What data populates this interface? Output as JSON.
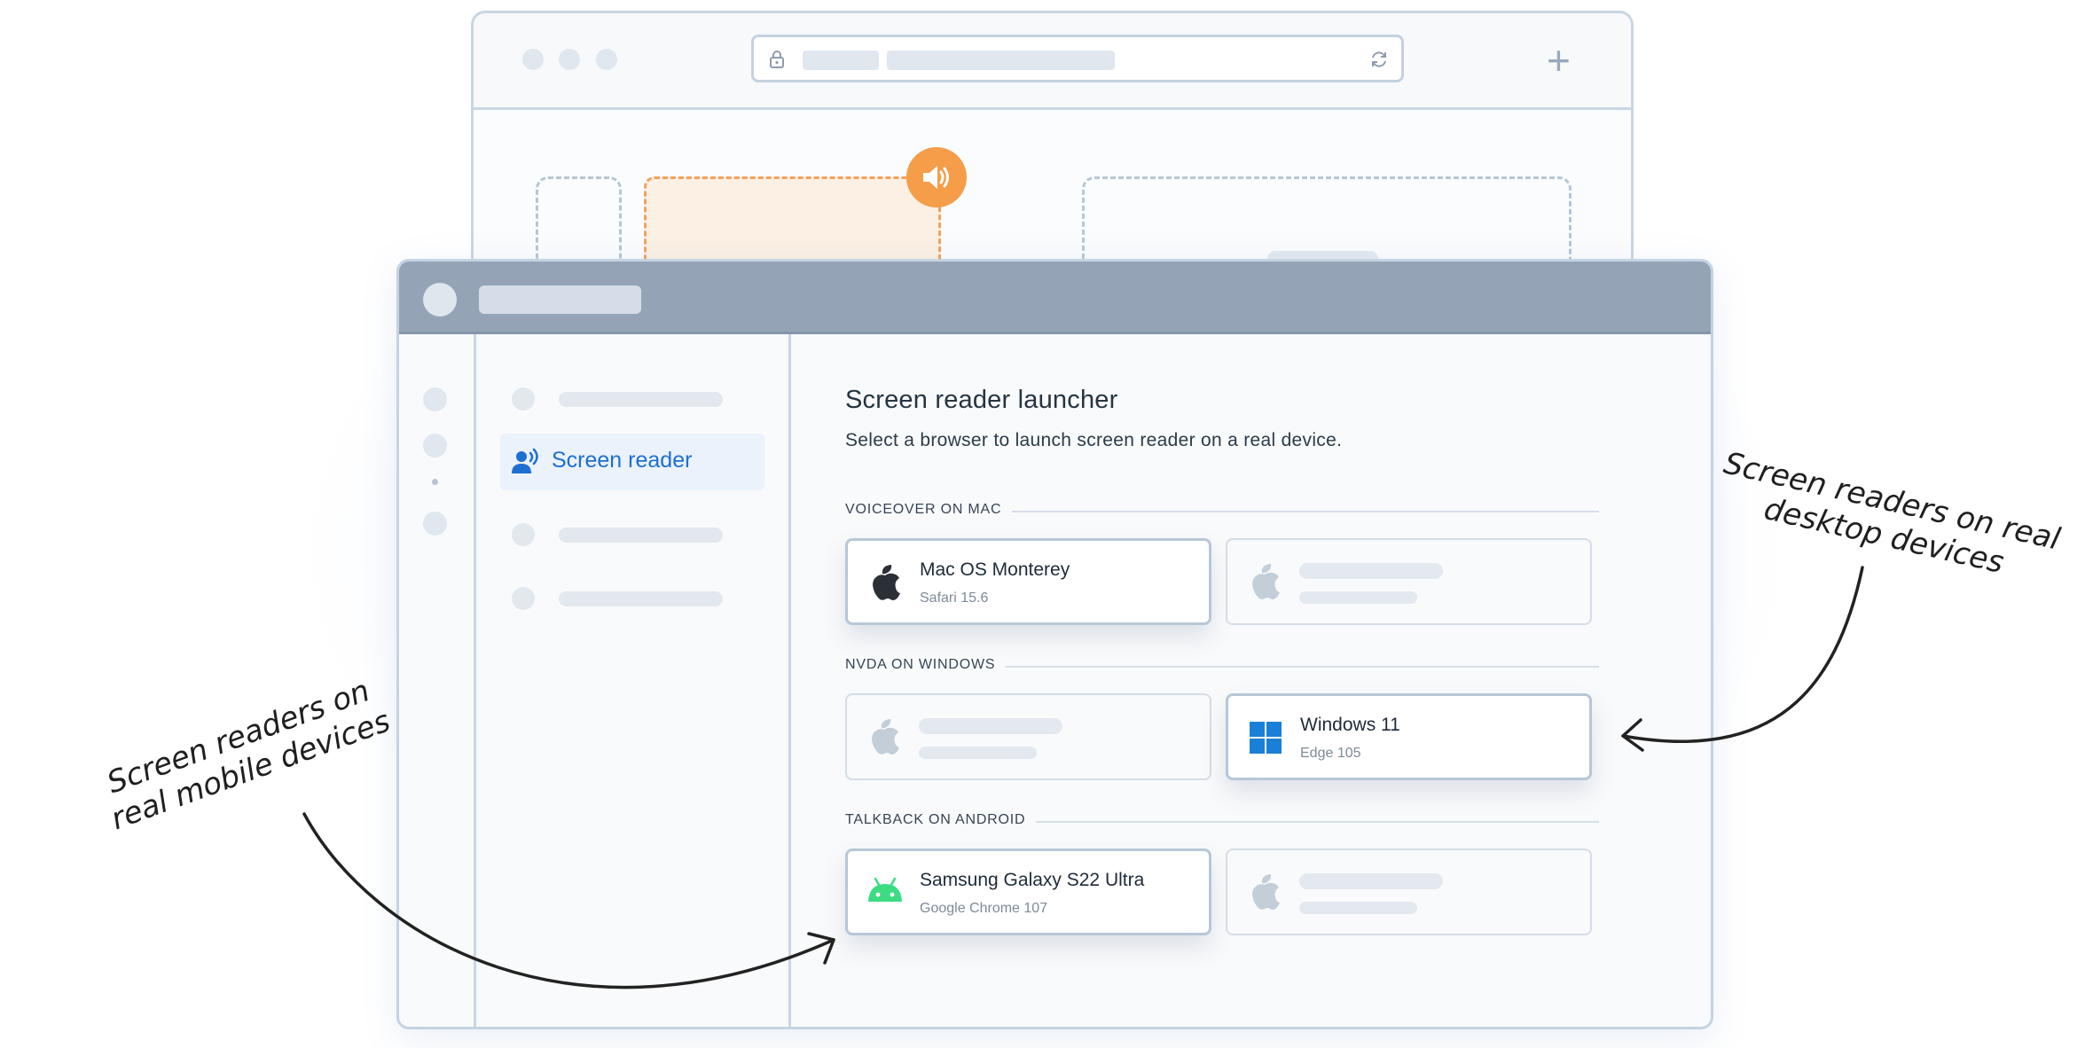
{
  "app": {
    "title": "Screen reader launcher",
    "subtitle": "Select a browser to launch screen reader on a real device."
  },
  "sidebar": {
    "active_item": {
      "label": "Screen reader",
      "icon": "speaking-person-icon"
    }
  },
  "sections": [
    {
      "heading": "VOICEOVER ON MAC",
      "device": {
        "name": "Mac OS Monterey",
        "browser": "Safari 15.6",
        "icon": "apple-icon"
      }
    },
    {
      "heading": "NVDA ON WINDOWS",
      "device": {
        "name": "Windows 11",
        "browser": "Edge 105",
        "icon": "windows-icon"
      }
    },
    {
      "heading": "TALKBACK ON ANDROID",
      "device": {
        "name": "Samsung Galaxy S22 Ultra",
        "browser": "Google Chrome 107",
        "icon": "android-icon"
      }
    }
  ],
  "annotations": {
    "desktop_line1": "Screen readers on real",
    "desktop_line2": "desktop devices",
    "mobile_line1": "Screen readers on",
    "mobile_line2": "real mobile devices"
  },
  "colors": {
    "accent_blue": "#1d6fd3",
    "accent_orange": "#f59d49",
    "windows_blue": "#1a7fd6",
    "android_green": "#3ddc84",
    "titlebar": "#94a4b6"
  },
  "icons": [
    "lock-icon",
    "refresh-icon",
    "plus-icon",
    "speaker-icon",
    "apple-icon",
    "windows-icon",
    "android-icon",
    "speaking-person-icon"
  ]
}
